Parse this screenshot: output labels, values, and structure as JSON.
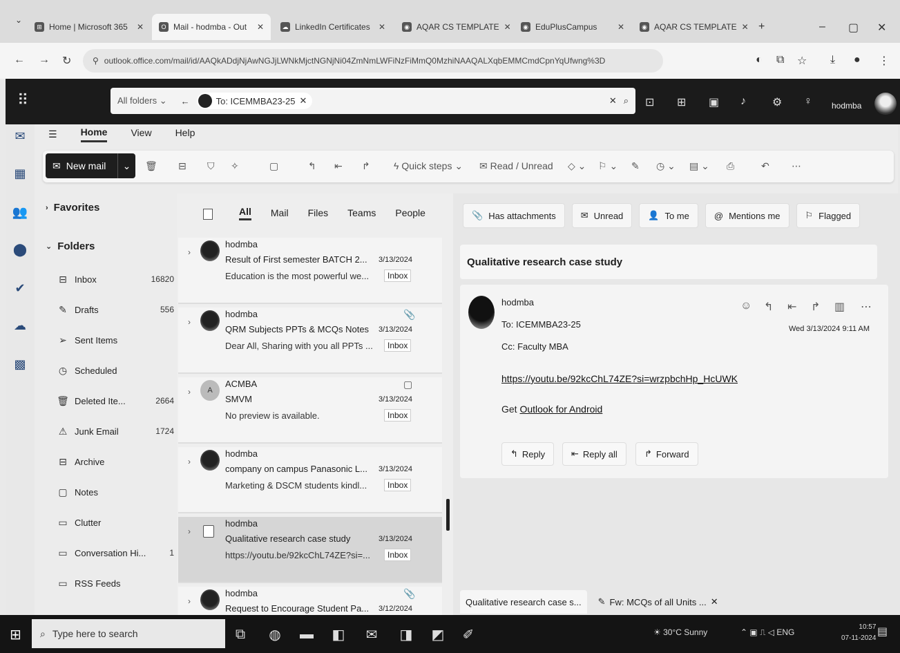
{
  "browser": {
    "tabs": [
      {
        "label": "Home | Microsoft 365",
        "active": false
      },
      {
        "label": "Mail - hodmba - Out",
        "active": true
      },
      {
        "label": "LinkedIn Certificates",
        "active": false
      },
      {
        "label": "AQAR CS TEMPLATE",
        "active": false
      },
      {
        "label": "EduPlusCampus",
        "active": false
      },
      {
        "label": "AQAR CS TEMPLATE",
        "active": false
      }
    ],
    "url": "outlook.office.com/mail/id/AAQkADdjNjAwNGJjLWNkMjctNGNjNi04ZmNmLWFiNzFiMmQ0MzhiNAAQALXqbEMMCmdCpnYqUfwng%3D"
  },
  "outlook": {
    "search": {
      "scope": "All folders",
      "chip": "To: ICEMMBA23-25"
    },
    "user": "hodmba",
    "ribbon_tabs": [
      "Home",
      "View",
      "Help"
    ],
    "ribbon_active": "Home",
    "commands": {
      "new_mail": "New mail",
      "quick_steps": "Quick steps",
      "read_unread": "Read / Unread"
    },
    "folders": {
      "favorites": "Favorites",
      "folders": "Folders",
      "items": [
        {
          "name": "Inbox",
          "count": "16820",
          "icon": "inbox-icon",
          "glyph": "⊟"
        },
        {
          "name": "Drafts",
          "count": "556",
          "icon": "pencil-icon",
          "glyph": "✎"
        },
        {
          "name": "Sent Items",
          "count": "",
          "icon": "send-icon",
          "glyph": "➢"
        },
        {
          "name": "Scheduled",
          "count": "",
          "icon": "clock-icon",
          "glyph": "◷"
        },
        {
          "name": "Deleted Ite...",
          "count": "2664",
          "icon": "trash-icon",
          "glyph": "🗑"
        },
        {
          "name": "Junk Email",
          "count": "1724",
          "icon": "junk-icon",
          "glyph": "⚠"
        },
        {
          "name": "Archive",
          "count": "",
          "icon": "archive-icon",
          "glyph": "⊟"
        },
        {
          "name": "Notes",
          "count": "",
          "icon": "notes-icon",
          "glyph": "▢"
        },
        {
          "name": "Clutter",
          "count": "",
          "icon": "folder-icon",
          "glyph": "▭"
        },
        {
          "name": "Conversation Hi...",
          "count": "1",
          "icon": "folder-icon",
          "glyph": "▭"
        },
        {
          "name": "RSS Feeds",
          "count": "",
          "icon": "folder-icon",
          "glyph": "▭"
        }
      ]
    },
    "list_filters": [
      "All",
      "Mail",
      "Files",
      "Teams",
      "People"
    ],
    "messages": [
      {
        "sender": "hodmba",
        "subject": "Result of First semester BATCH 2...",
        "date": "3/13/2024",
        "preview": "Education is the most powerful we...",
        "folder": "Inbox",
        "avatar": "photo",
        "icon": ""
      },
      {
        "sender": "hodmba",
        "subject": "QRM Subjects PPTs & MCQs Notes",
        "date": "3/13/2024",
        "preview": "Dear All, Sharing with you all PPTs ...",
        "folder": "Inbox",
        "avatar": "photo",
        "icon": "📎"
      },
      {
        "sender": "ACMBA",
        "subject": "SMVM",
        "date": "3/13/2024",
        "preview": "No preview is available.",
        "folder": "Inbox",
        "avatar": "initials",
        "initials": "A",
        "icon": "▢"
      },
      {
        "sender": "hodmba",
        "subject": "company on campus Panasonic L...",
        "date": "3/13/2024",
        "preview": "Marketing & DSCM students kindl...",
        "folder": "Inbox",
        "avatar": "photo",
        "icon": ""
      },
      {
        "sender": "hodmba",
        "subject": "Qualitative research case study",
        "date": "3/13/2024",
        "preview": "https://youtu.be/92kcChL74ZE?si=...",
        "folder": "Inbox",
        "avatar": "check",
        "icon": "",
        "selected": true
      },
      {
        "sender": "hodmba",
        "subject": "Request to Encourage Student Pa...",
        "date": "3/12/2024",
        "preview": "",
        "folder": "",
        "avatar": "photo",
        "icon": "📎"
      }
    ],
    "quick_filters": [
      {
        "label": "Has attachments",
        "icon": "paperclip-icon",
        "glyph": "📎"
      },
      {
        "label": "Unread",
        "icon": "unread-icon",
        "glyph": "✉"
      },
      {
        "label": "To me",
        "icon": "person-icon",
        "glyph": "👤"
      },
      {
        "label": "Mentions me",
        "icon": "at-icon",
        "glyph": "@"
      },
      {
        "label": "Flagged",
        "icon": "flag-icon",
        "glyph": "⚐"
      }
    ],
    "reading": {
      "subject": "Qualitative research case study",
      "from": "hodmba",
      "to": "To: ICEMMBA23-25",
      "cc": "Cc: Faculty MBA",
      "when": "Wed 3/13/2024 9:11 AM",
      "link": "https://youtu.be/92kcChL74ZE?si=wrzpbchHp_HcUWK",
      "get_prefix": "Get ",
      "get_link": "Outlook for Android",
      "reply": "Reply",
      "reply_all": "Reply all",
      "forward": "Forward"
    },
    "bottom_tabs": [
      {
        "label": "Qualitative research case s...",
        "active": true
      },
      {
        "label": "Fw: MCQs of all Units ...",
        "active": false
      }
    ]
  },
  "taskbar": {
    "search_placeholder": "Type here to search",
    "weather": "30°C Sunny",
    "lang": "ENG",
    "time": "10:57",
    "date": "07-11-2024"
  }
}
